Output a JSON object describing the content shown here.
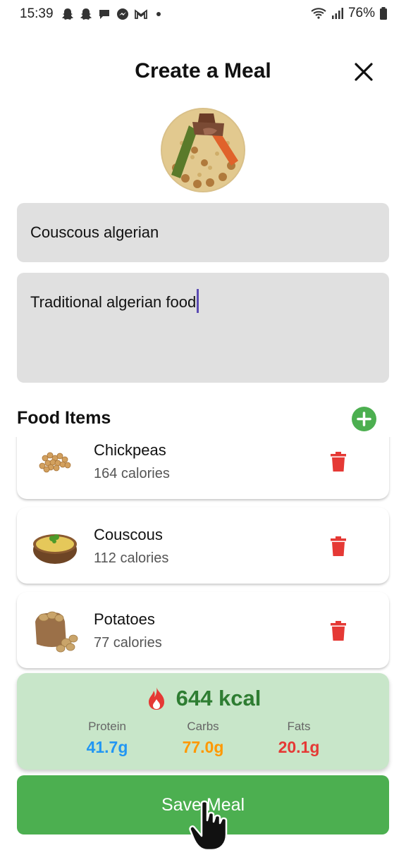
{
  "status_bar": {
    "time": "15:39",
    "battery": "76%",
    "icons": [
      "snapchat-icon",
      "snapchat-icon",
      "chat-icon",
      "messenger-icon",
      "gmail-icon",
      "dot-icon",
      "wifi-icon",
      "signal-icon",
      "battery-icon"
    ]
  },
  "header": {
    "title": "Create a Meal",
    "close_icon": "close-icon"
  },
  "form": {
    "name_value": "Couscous algerian",
    "description_value": "Traditional algerian food"
  },
  "food_items": {
    "title": "Food Items",
    "add_icon": "plus-icon",
    "items": [
      {
        "name": "Chickpeas",
        "calories": "164 calories",
        "image": "chickpeas-image"
      },
      {
        "name": "Couscous",
        "calories": "112 calories",
        "image": "couscous-bowl-image"
      },
      {
        "name": "Potatoes",
        "calories": "77 calories",
        "image": "potatoes-sack-image"
      }
    ]
  },
  "summary": {
    "kcal": "644 kcal",
    "icon": "fire-icon",
    "macros": [
      {
        "label": "Protein",
        "value": "41.7g",
        "color": "#2196f3"
      },
      {
        "label": "Carbs",
        "value": "77.0g",
        "color": "#ff9800"
      },
      {
        "label": "Fats",
        "value": "20.1g",
        "color": "#e53935"
      }
    ]
  },
  "save": {
    "label": "Save Meal"
  },
  "colors": {
    "accent": "#4caf50",
    "summary_bg": "#c8e6c9",
    "kcal_text": "#2e7d32",
    "delete": "#e53935",
    "field_bg": "#e0e0e0"
  }
}
